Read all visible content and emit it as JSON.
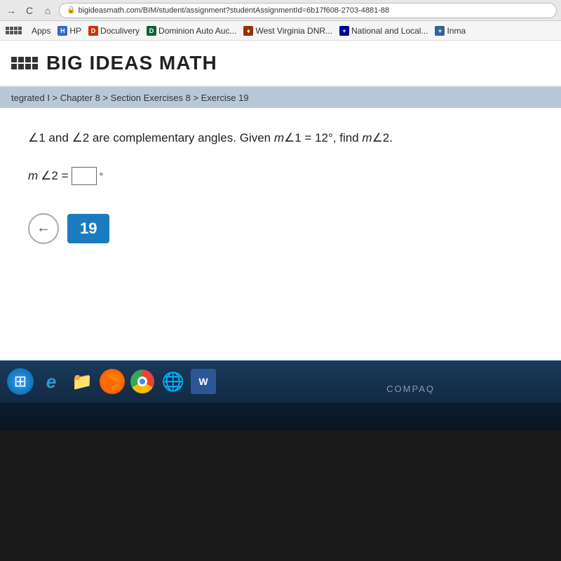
{
  "browser": {
    "nav": {
      "back": "→",
      "refresh": "C",
      "home": "⌂"
    },
    "address": "bigideasmath.com/BIM/student/assignment?studentAssignmentId=6b17f608-2703-4881-88",
    "tab_title": "Big Ideas Math"
  },
  "bookmarks": {
    "apps_label": "Apps",
    "items": [
      {
        "id": "hp",
        "label": "HP",
        "color": "#3366cc"
      },
      {
        "id": "doculivery",
        "label": "Doculivery",
        "color": "#cc3300"
      },
      {
        "id": "dominion",
        "label": "Dominion Auto Auc...",
        "color": "#006633"
      },
      {
        "id": "wv",
        "label": "West Virginia DNR...",
        "color": "#993300"
      },
      {
        "id": "national",
        "label": "National and Local...",
        "color": "#000099"
      },
      {
        "id": "inma",
        "label": "Inma",
        "color": "#336699"
      }
    ]
  },
  "header": {
    "title": "BIG IDEAS MATH"
  },
  "breadcrumb": "tegrated I > Chapter 8 > Section Exercises 8 > Exercise 19",
  "exercise": {
    "number": "19",
    "problem_text_1": "∠1 and ∠2 are complementary angles. Given ",
    "problem_math": "m∠1 = 12°",
    "problem_text_2": ", find ",
    "problem_math2": "m∠2",
    "problem_end": ".",
    "answer_label": "m∠2 =",
    "answer_placeholder": "",
    "degree": "°"
  },
  "taskbar": {
    "compaq_label": "COMPAQ",
    "icons": [
      {
        "id": "start",
        "symbol": "⊞"
      },
      {
        "id": "ie",
        "symbol": "e"
      },
      {
        "id": "folder",
        "symbol": "📁"
      },
      {
        "id": "media",
        "symbol": "▶"
      },
      {
        "id": "chrome",
        "symbol": ""
      },
      {
        "id": "edge",
        "symbol": "e"
      },
      {
        "id": "word",
        "symbol": "W"
      }
    ]
  }
}
